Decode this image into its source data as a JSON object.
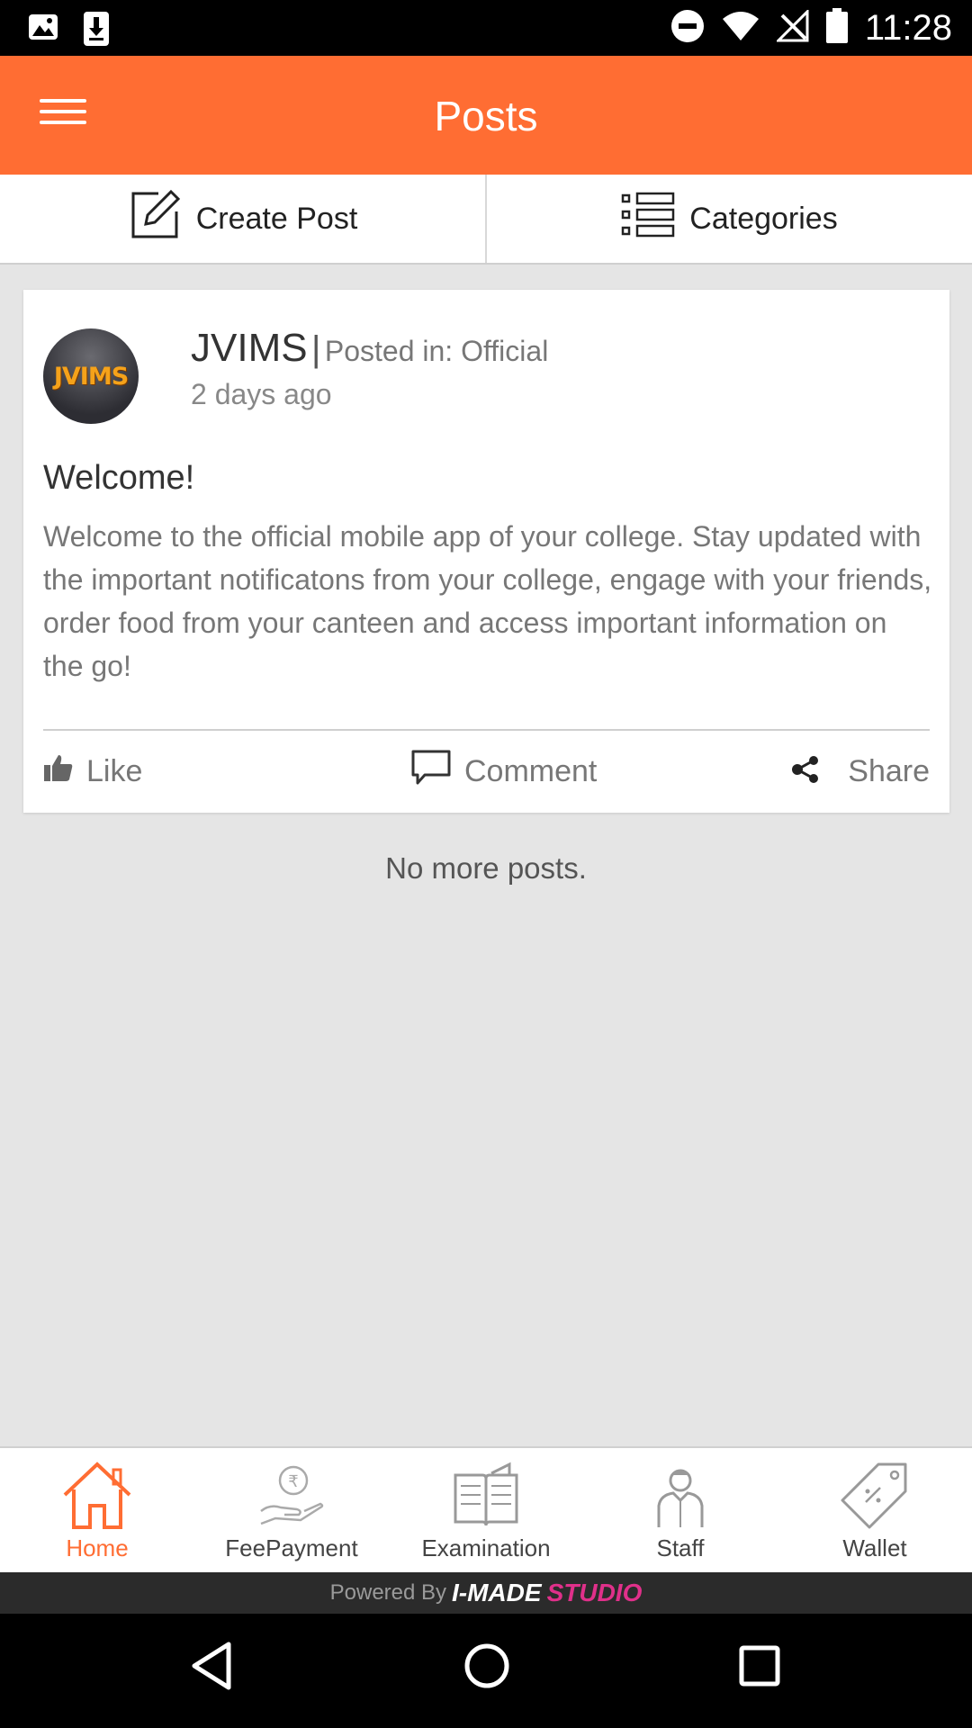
{
  "status_bar": {
    "time": "11:28"
  },
  "app_bar": {
    "title": "Posts"
  },
  "actions": {
    "create_post": "Create Post",
    "categories": "Categories"
  },
  "post": {
    "author": "JVIMS",
    "separator": "|",
    "posted_in": "Posted in: Official",
    "time": "2 days ago",
    "avatar_text": "JVIMS",
    "title": "Welcome!",
    "body": "Welcome to the official mobile app of your college. Stay updated with the important notificatons from your college, engage with your friends, order food from your canteen and access important information on the go!",
    "like_label": "Like",
    "comment_label": "Comment",
    "share_label": "Share"
  },
  "feed": {
    "end_message": "No more posts."
  },
  "bottom_nav": {
    "items": [
      {
        "label": "Home",
        "icon": "home-icon",
        "active": true
      },
      {
        "label": "FeePayment",
        "icon": "fee-payment-icon",
        "active": false
      },
      {
        "label": "Examination",
        "icon": "book-icon",
        "active": false
      },
      {
        "label": "Staff",
        "icon": "staff-icon",
        "active": false
      },
      {
        "label": "Wallet",
        "icon": "tag-icon",
        "active": false
      }
    ]
  },
  "footer": {
    "prefix": "Powered By",
    "brand_part1": "I-MADE",
    "brand_part2": "STUDIO"
  },
  "colors": {
    "accent": "#ff6d33",
    "brand_pink": "#e0308a"
  }
}
